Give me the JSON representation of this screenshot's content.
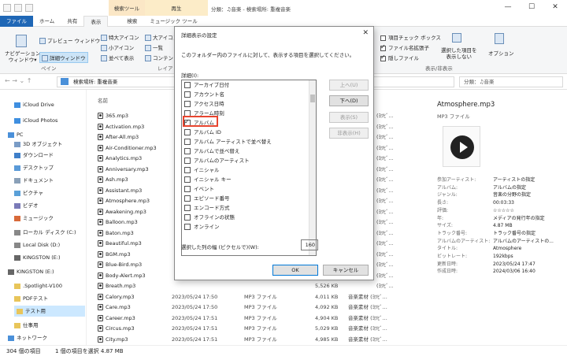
{
  "titlebar": {
    "tool_group_search": "検索ツール",
    "tool_group_play": "再生",
    "window_title": "分類：♫音楽 - 検索場所: 重複音楽",
    "min": "—",
    "max": "☐",
    "close": "✕"
  },
  "tabs": [
    {
      "label": "ファイル"
    },
    {
      "label": "ホーム"
    },
    {
      "label": "共有"
    },
    {
      "label": "表示"
    },
    {
      "label": "検索"
    },
    {
      "label": "ミュージック ツール"
    }
  ],
  "ribbon": {
    "nav_pane": "ナビゲーション\nウィンドウ▾",
    "preview_pane": "プレビュー ウィンドウ",
    "details_pane": "詳細ウィンドウ",
    "pane_group": "ペイン",
    "layout_items": [
      "特大アイコン",
      "大アイコン",
      "小アイコン",
      "一覧",
      "並べて表示",
      "コンテン"
    ],
    "layout_group": "レイア",
    "show_items": [
      {
        "label": "項目チェック ボックス",
        "checked": false
      },
      {
        "label": "ファイル名拡張子",
        "checked": true
      },
      {
        "label": "隠しファイル",
        "checked": true
      }
    ],
    "hide_selected": "選択した項目を\n表示しない",
    "options": "オプション",
    "show_group": "表示/非表示"
  },
  "address": {
    "path": "検索場所: 重複音楽",
    "search_placeholder": "分類：♫音楽"
  },
  "nav": [
    {
      "label": "iCloud Drive",
      "icon": "cloud-icon"
    },
    {
      "label": "iCloud Photos",
      "icon": "photos-icon"
    },
    {
      "label": "PC",
      "icon": "pc-icon"
    },
    {
      "label": "3D オブジェクト",
      "icon": "3d-object-icon"
    },
    {
      "label": "ダウンロード",
      "icon": "download-icon"
    },
    {
      "label": "デスクトップ",
      "icon": "desktop-icon"
    },
    {
      "label": "ドキュメント",
      "icon": "document-icon"
    },
    {
      "label": "ピクチャ",
      "icon": "picture-icon"
    },
    {
      "label": "ビデオ",
      "icon": "video-icon"
    },
    {
      "label": "ミュージック",
      "icon": "music-icon"
    },
    {
      "label": "ローカル ディスク (C:)",
      "icon": "drive-icon"
    },
    {
      "label": "Local Disk (D:)",
      "icon": "drive-icon"
    },
    {
      "label": "KINGSTON (E:)",
      "icon": "usb-icon"
    },
    {
      "label": "KINGSTON (E:)",
      "icon": "usb-icon"
    },
    {
      "label": ".Spotlight-V100",
      "icon": "folder-icon"
    },
    {
      "label": "PDFテスト",
      "icon": "folder-icon"
    },
    {
      "label": "テスト用",
      "icon": "folder-icon"
    },
    {
      "label": "仕事用",
      "icon": "folder-icon"
    },
    {
      "label": "ネットワーク",
      "icon": "network-icon"
    }
  ],
  "filelist": {
    "header_name": "名前",
    "files": [
      "365.mp3",
      "Activation.mp3",
      "After-All.mp3",
      "Air-Conditioner.mp3",
      "Analytics.mp3",
      "Anniversary.mp3",
      "Ash.mp3",
      "Assistant.mp3",
      "Atmosphere.mp3",
      "Awakening.mp3",
      "Balloon.mp3",
      "Baton.mp3",
      "Beautiful.mp3",
      "BGM.mp3",
      "Blue-Bird.mp3",
      "Body-Alert.mp3",
      "Breath.mp3",
      "Calory.mp3",
      "Care.mp3",
      "Career.mp3",
      "Circus.mp3",
      "City.mp3"
    ],
    "visible_rows": [
      {
        "date": "2023/05/24 17:50",
        "type": "MP3 ファイル",
        "size": "4,011 KB",
        "artist": "音楽素材 (ﾖﾂﾋﾞ..."
      },
      {
        "date": "2023/05/24 17:50",
        "type": "MP3 ファイル",
        "size": "4,092 KB",
        "artist": "音楽素材 (ﾖﾂﾋﾞ..."
      },
      {
        "date": "2023/05/24 17:51",
        "type": "MP3 ファイル",
        "size": "4,904 KB",
        "artist": "音楽素材 (ﾖﾂﾋﾞ..."
      },
      {
        "date": "2023/05/24 17:51",
        "type": "MP3 ファイル",
        "size": "5,029 KB",
        "artist": "音楽素材 (ﾖﾂﾋﾞ..."
      },
      {
        "date": "2023/05/24 17:51",
        "type": "MP3 ファイル",
        "size": "4,985 KB",
        "artist": "音楽素材 (ﾖﾂﾋﾞ..."
      }
    ],
    "breath_size": "5,526 KB",
    "right_col_label": "(ﾖﾂﾋﾞ..."
  },
  "details": {
    "title": "Atmosphere.mp3",
    "subtitle": "MP3 ファイル",
    "props": [
      {
        "k": "参加アーティスト:",
        "v": "アーティストの指定"
      },
      {
        "k": "アルバム:",
        "v": "アルバムの指定"
      },
      {
        "k": "ジャンル:",
        "v": "音楽の分野の指定"
      },
      {
        "k": "長さ:",
        "v": "00:03:33"
      },
      {
        "k": "評価:",
        "v": "☆☆☆☆☆"
      },
      {
        "k": "年:",
        "v": "メディアの発行年の指定"
      },
      {
        "k": "サイズ:",
        "v": "4.87 MB"
      },
      {
        "k": "トラック番号:",
        "v": "トラック番号の指定"
      },
      {
        "k": "アルバムのアーティスト:",
        "v": "アルバムのアーティストの..."
      },
      {
        "k": "タイトル:",
        "v": "Atmosphere"
      },
      {
        "k": "ビットレート:",
        "v": "192kbps"
      },
      {
        "k": "更新日時:",
        "v": "2023/05/24 17:47"
      },
      {
        "k": "作成日時:",
        "v": "2024/03/06 16:40"
      }
    ]
  },
  "status": {
    "count": "304 個の項目",
    "selection": "1 個の項目を選択 4.87 MB"
  },
  "dialog": {
    "title": "詳細表示の設定",
    "close": "✕",
    "instruction": "このフォルダー内のファイルに対して、表示する項目を選択してください。",
    "list_label": "詳細(I):",
    "items": [
      {
        "label": "アーカイブ日付",
        "checked": false
      },
      {
        "label": "アカウント名",
        "checked": false
      },
      {
        "label": "アクセス日時",
        "checked": false
      },
      {
        "label": "アラーム時刻",
        "checked": false
      },
      {
        "label": "アルバム",
        "checked": true
      },
      {
        "label": "アルバム ID",
        "checked": false
      },
      {
        "label": "アルバム アーティストで並べ替え",
        "checked": false
      },
      {
        "label": "アルバムで並べ替え",
        "checked": false
      },
      {
        "label": "アルバムのアーティスト",
        "checked": false
      },
      {
        "label": "イニシャル",
        "checked": false
      },
      {
        "label": "イニシャル キー",
        "checked": false
      },
      {
        "label": "イベント",
        "checked": false
      },
      {
        "label": "エピソード番号",
        "checked": false
      },
      {
        "label": "エンコード方式",
        "checked": false
      },
      {
        "label": "オフラインの状態",
        "checked": false
      },
      {
        "label": "オンライン",
        "checked": false
      }
    ],
    "btn_up": "上へ(U)",
    "btn_down": "下へ(D)",
    "btn_show": "表示(S)",
    "btn_hide": "非表示(H)",
    "width_label": "選択した列の幅 (ピクセルで)(W):",
    "width_value": "160",
    "ok": "OK",
    "cancel": "キャンセル"
  }
}
